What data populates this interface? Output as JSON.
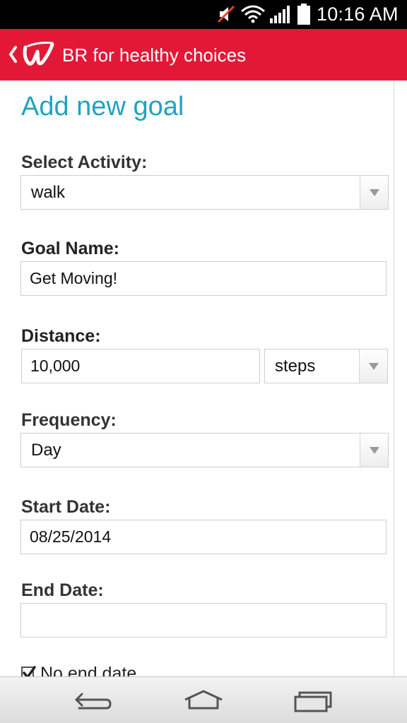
{
  "status_bar": {
    "time": "10:16 AM",
    "icons": [
      "mute-icon",
      "wifi-icon",
      "signal-icon",
      "battery-icon"
    ]
  },
  "app_bar": {
    "title": "BR for healthy choices",
    "brand_color": "#e31837",
    "icons": [
      "back-chevron-icon",
      "walgreens-w-logo"
    ]
  },
  "page": {
    "title": "Add new goal",
    "title_color": "#1fa3c4"
  },
  "form": {
    "activity": {
      "label": "Select Activity:",
      "value": "walk"
    },
    "goal_name": {
      "label": "Goal Name:",
      "value": "Get Moving!"
    },
    "distance": {
      "label": "Distance:",
      "value": "10,000",
      "unit": "steps"
    },
    "frequency": {
      "label": "Frequency:",
      "value": "Day"
    },
    "start_date": {
      "label": "Start Date:",
      "value": "08/25/2014"
    },
    "end_date": {
      "label": "End Date:",
      "value": ""
    },
    "no_end_date": {
      "label": "No end date",
      "checked": true
    }
  },
  "nav_bar": {
    "icons": [
      "back-icon",
      "home-icon",
      "recent-apps-icon"
    ]
  }
}
